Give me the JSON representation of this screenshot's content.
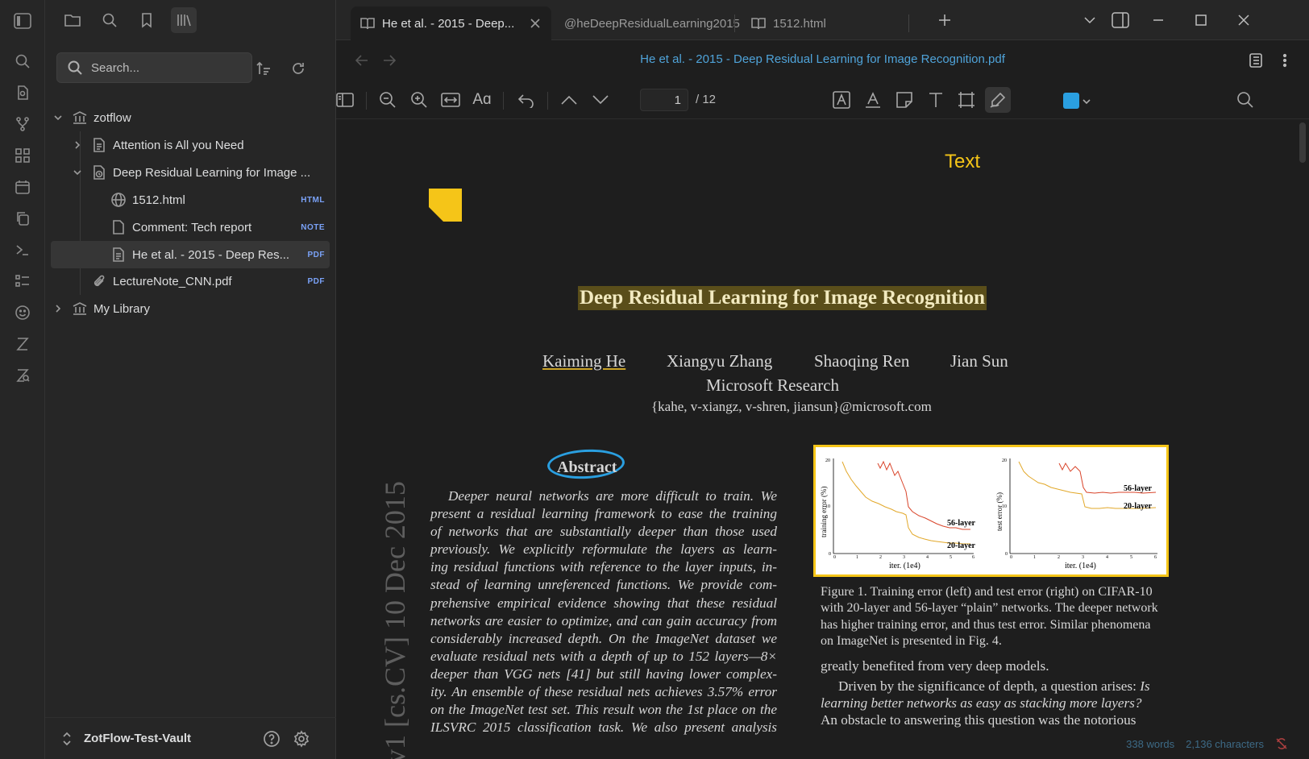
{
  "tabs": [
    {
      "label": "He et al. - 2015 - Deep...",
      "icon": "book-open-icon",
      "active": true
    },
    {
      "label": "@heDeepResidualLearning2015",
      "icon": "",
      "active": false
    },
    {
      "label": "1512.html",
      "icon": "book-open-icon",
      "active": false
    }
  ],
  "sidebar": {
    "search_placeholder": "Search...",
    "tree": [
      {
        "label": "zotflow",
        "icon": "library-icon",
        "level": 0,
        "expanded": true
      },
      {
        "label": "Attention is All you Need",
        "icon": "document-icon",
        "level": 1,
        "expanded": false
      },
      {
        "label": "Deep Residual Learning for Image ...",
        "icon": "recent-document-icon",
        "level": 1,
        "expanded": true
      },
      {
        "label": "1512.html",
        "icon": "globe-icon",
        "level": 2,
        "badge": "HTML"
      },
      {
        "label": "Comment: Tech report",
        "icon": "note-icon",
        "level": 2,
        "badge": "NOTE"
      },
      {
        "label": "He et al. - 2015 - Deep Res...",
        "icon": "pdf-document-icon",
        "level": 2,
        "badge": "PDF",
        "selected": true
      },
      {
        "label": "LectureNote_CNN.pdf",
        "icon": "paperclip-icon",
        "level": 1,
        "badge": "PDF"
      },
      {
        "label": "My Library",
        "icon": "library-icon",
        "level": 0,
        "expanded": false
      }
    ],
    "vault_name": "ZotFlow-Test-Vault"
  },
  "view": {
    "title": "He et al. - 2015 - Deep Residual Learning for Image Recognition.pdf",
    "page_current": "1",
    "page_total": "/ 12",
    "annotation_color": "#2a9fe0"
  },
  "pdf": {
    "freetext_annotation": "Text",
    "title": "Deep Residual Learning for Image Recognition",
    "authors": [
      "Kaiming He",
      "Xiangyu Zhang",
      "Shaoqing Ren",
      "Jian Sun"
    ],
    "affiliation": "Microsoft Research",
    "email": "{kahe, v-xiangz, v-shren, jiansun}@microsoft.com",
    "arxiv_stamp": "v1  [cs.CV]  10 Dec 2015",
    "abstract_heading": "Abstract",
    "abstract_lines": [
      "Deeper neural networks are more difficult to train.  We",
      "present a residual learning framework to ease the training",
      "of networks that are substantially deeper than those used",
      "previously.  We explicitly reformulate the layers as learn-",
      "ing residual functions with reference to the layer inputs, in-",
      "stead of learning unreferenced functions. We provide com-",
      "prehensive empirical evidence showing that these residual",
      "networks are easier to optimize, and can gain accuracy from",
      "considerably increased depth.  On the ImageNet dataset we",
      "evaluate residual nets with a depth of up to 152 layers—8×",
      "deeper than VGG nets [41] but still having lower complex-",
      "ity. An ensemble of these residual nets achieves 3.57% error",
      "on the ImageNet test set. This result won the 1st place on the",
      "ILSVRC 2015 classification task.  We also present analysis"
    ],
    "figure": {
      "left_ylabel": "training error (%)",
      "right_ylabel": "test error (%)",
      "xlabel": "iter. (1e4)",
      "series_labels": [
        "56-layer",
        "20-layer"
      ],
      "x_ticks": [
        "0",
        "1",
        "2",
        "3",
        "4",
        "5",
        "6"
      ],
      "y_ticks_left": [
        "20",
        "10",
        "0"
      ],
      "y_ticks_right": [
        "20",
        "10",
        "0"
      ]
    },
    "figure_caption_lines": [
      "Figure 1. Training error (left) and test error (right) on CIFAR-10",
      "with 20-layer and 56-layer “plain” networks. The deeper network",
      "has higher training error, and thus test error.  Similar phenomena",
      "on ImageNet is presented in Fig. 4."
    ],
    "right_col_line1": "greatly benefited from very deep models.",
    "right_col_line2_plain": "Driven by the significance of depth, a question arises: ",
    "right_col_line2_italic": "Is",
    "right_col_line3": "learning better networks as easy as stacking more layers?",
    "right_col_line4": "An obstacle to answering this question was the notorious"
  },
  "status": {
    "characters": "2,136 characters",
    "words": "338 words"
  }
}
